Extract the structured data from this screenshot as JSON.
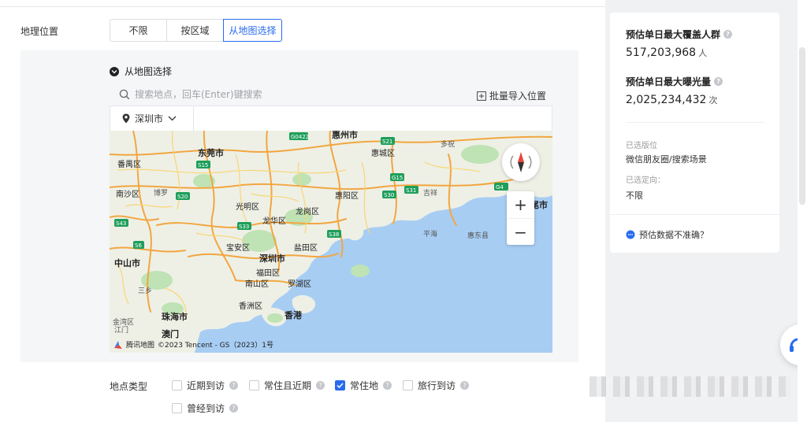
{
  "geo": {
    "label": "地理位置",
    "options": [
      "不限",
      "按区域",
      "从地图选择"
    ],
    "selected": "从地图选择"
  },
  "map_section": {
    "title": "从地图选择",
    "search_placeholder": "搜索地点，回车(Enter)键搜索",
    "batch_import": "批量导入位置",
    "city": "深圳市"
  },
  "map": {
    "labels": {
      "huizhou": "惠州市",
      "dongguan": "东莞市",
      "huicheng": "惠城区",
      "boluo": "博罗",
      "huiyang": "惠阳区",
      "nansha": "南沙区",
      "guangming": "光明区",
      "longhua": "龙华区",
      "longgang": "龙岗区",
      "baoan": "宝安区",
      "shenzhen": "深圳市",
      "futian": "福田区",
      "nanshan": "南山区",
      "luohu": "罗湖区",
      "yantian": "盐田区",
      "zhongshan": "中山市",
      "zhuhai": "珠海市",
      "hongkong": "香港",
      "macau": "澳门",
      "jiangmen": "江门",
      "xiangzhou": "香洲区",
      "panyu": "番禺区",
      "sanxiang": "三乡",
      "huidong": "惠东县",
      "pinghai": "平海",
      "duoxiang": "多祝",
      "jixiang": "吉祥",
      "weimi": "尾市",
      "jinchuan": "金湾区"
    },
    "roads": [
      "S21",
      "S30",
      "G15",
      "S33",
      "S43",
      "S38",
      "G0422",
      "S15",
      "S31",
      "G4",
      "S20",
      "S6"
    ],
    "brand": "腾讯地图",
    "copyright": "©2023 Tencent - GS（2023）1号"
  },
  "location_type": {
    "label": "地点类型",
    "options": [
      {
        "label": "近期到访",
        "checked": false
      },
      {
        "label": "常住且近期",
        "checked": false
      },
      {
        "label": "常住地",
        "checked": true
      },
      {
        "label": "旅行到访",
        "checked": false
      },
      {
        "label": "曾经到访",
        "checked": false
      }
    ]
  },
  "estimate": {
    "max_coverage_title": "预估单日最大覆盖人群",
    "max_coverage_value": "517,203,968",
    "max_coverage_unit": "人",
    "max_exposure_title": "预估单日最大曝光量",
    "max_exposure_value": "2,025,234,432",
    "max_exposure_unit": "次",
    "placement_label": "已选版位",
    "placement_value": "微信朋友圈/搜索场景",
    "targeting_label": "已选定向：",
    "targeting_value": "不限",
    "inaccurate_link": "预估数据不准确？"
  },
  "colors": {
    "primary": "#296bef",
    "water": "#a8cdf3",
    "land": "#eef0e6",
    "green": "#bfe3b4",
    "road_orange": "#f2a640",
    "road_yellow": "#f9d675",
    "highway_green": "#1e9e5a"
  }
}
